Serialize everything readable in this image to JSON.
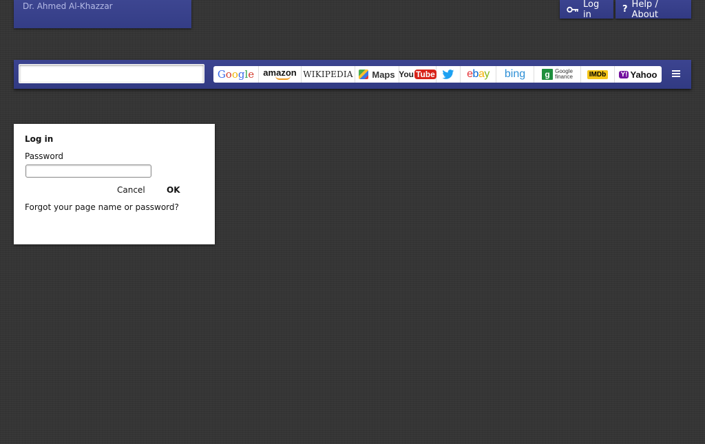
{
  "header": {
    "owner_name": "Dr. Ahmed Al-Khazzar",
    "login_label": "Log in",
    "help_label": "Help / About"
  },
  "search": {
    "placeholder": "",
    "engines": [
      {
        "name": "Google",
        "icon": "google-logo"
      },
      {
        "name": "amazon",
        "icon": "amazon-logo"
      },
      {
        "name": "Wikipedia",
        "display": "WIKIPEDIA",
        "icon": "wikipedia-logo"
      },
      {
        "name": "Maps",
        "icon": "google-maps-logo"
      },
      {
        "name": "YouTube",
        "you": "You",
        "tube": "Tube",
        "icon": "youtube-logo"
      },
      {
        "name": "Twitter",
        "icon": "twitter-bird-icon"
      },
      {
        "name": "ebay",
        "icon": "ebay-logo"
      },
      {
        "name": "bing",
        "icon": "bing-logo"
      },
      {
        "name": "Google finance",
        "line1": "Google",
        "line2": "finance",
        "letter": "g",
        "icon": "google-finance-logo"
      },
      {
        "name": "IMDb",
        "icon": "imdb-logo"
      },
      {
        "name": "Yahoo",
        "badge": "Y!",
        "icon": "yahoo-logo"
      }
    ]
  },
  "login_dialog": {
    "title": "Log in",
    "password_label": "Password",
    "password_value": "",
    "cancel_label": "Cancel",
    "ok_label": "OK",
    "forgot_link": "Forgot your page name or password?"
  },
  "colors": {
    "header_blue": "#3a4390",
    "background": "#353535",
    "dialog_bg": "#ffffff"
  }
}
